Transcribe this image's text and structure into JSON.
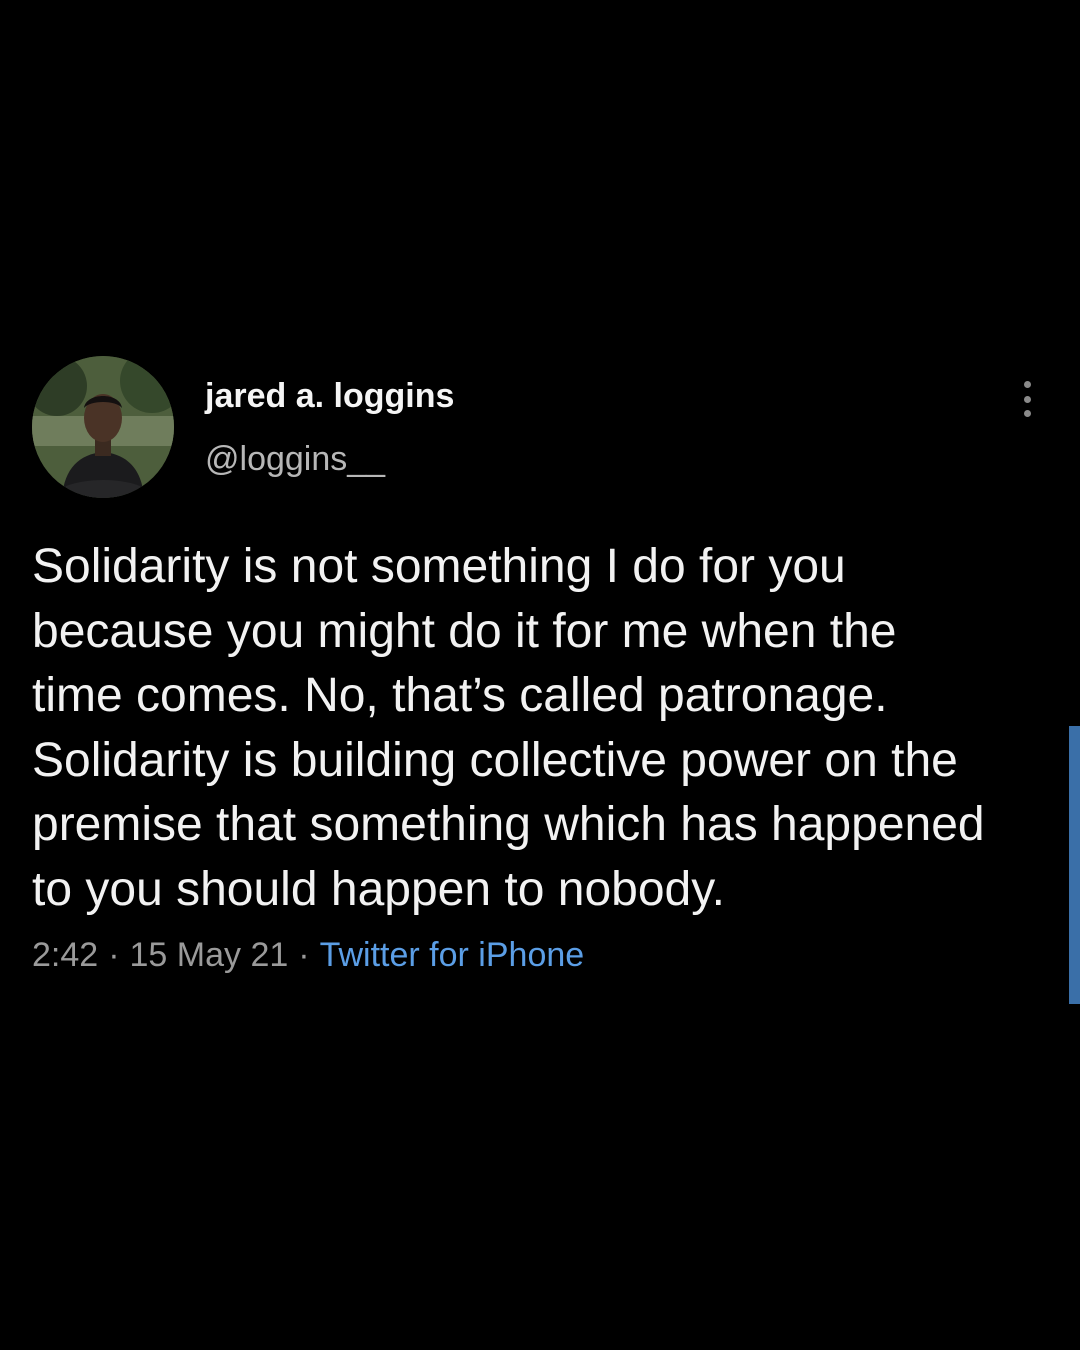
{
  "tweet": {
    "author": {
      "display_name": "jared a. loggins",
      "handle": "@loggins__"
    },
    "text": "Solidarity is not something I do for you\nbecause you might do it for me when the\ntime comes. No, that’s called patronage.\nSolidarity is building collective power on the\npremise that something which has happened\nto you should happen to nobody.",
    "time": "2:42",
    "date": "15 May 21",
    "separator": "·",
    "source": "Twitter for iPhone",
    "more_icon": "vertical-ellipsis-icon"
  },
  "colors": {
    "background": "#000000",
    "text": "#f2f2f2",
    "secondary_text": "#9a9a9a",
    "link": "#5b9ee6",
    "scrollbar": "#3a6fa8"
  }
}
